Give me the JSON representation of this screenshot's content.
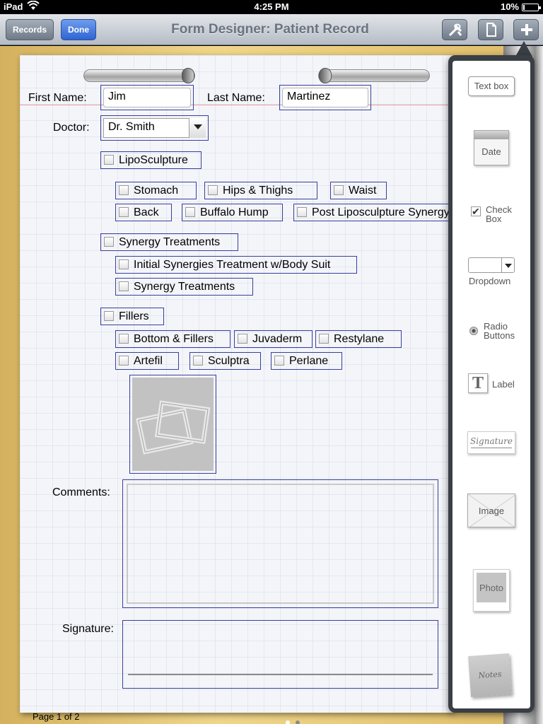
{
  "status": {
    "carrier": "iPad",
    "time": "4:25 PM",
    "battery": "10%",
    "battery_level": 0.1
  },
  "nav": {
    "records_label": "Records",
    "done_label": "Done",
    "title": "Form Designer: Patient Record"
  },
  "form": {
    "first_name": {
      "label": "First Name:",
      "value": "Jim"
    },
    "last_name": {
      "label": "Last Name:",
      "value": "Martinez"
    },
    "doctor": {
      "label": "Doctor:",
      "value": "Dr. Smith"
    },
    "checkboxes": {
      "liposculpture": "LipoSculpture",
      "stomach": "Stomach",
      "hips_thighs": "Hips & Thighs",
      "waist": "Waist",
      "back": "Back",
      "buffalo_hump": "Buffalo Hump",
      "post_lipo": "Post Liposculpture Synergy",
      "synergy_treatments": "Synergy Treatments",
      "initial_synergies": "Initial Synergies Treatment w/Body Suit",
      "synergy_treatments_sub": "Synergy Treatments",
      "fillers": "Fillers",
      "bottom_fillers": "Bottom & Fillers",
      "juvaderm": "Juvaderm",
      "restylane": "Restylane",
      "artefil": "Artefil",
      "sculptra": "Sculptra",
      "perlane": "Perlane"
    },
    "comments_label": "Comments:",
    "signature_label": "Signature:",
    "page_indicator": "Page 1 of 2"
  },
  "palette": {
    "text_box": "Text box",
    "date": "Date",
    "check_box": "Check\nBox",
    "dropdown": "Dropdown",
    "radio": "Radio\nButtons",
    "label": "Label",
    "signature": "Signature",
    "image": "Image",
    "photo": "Photo",
    "notes": "Notes"
  },
  "colors": {
    "field_border": "#3a3f9c",
    "done_button": "#2f64d3",
    "palette_frame": "#3a3f46"
  }
}
